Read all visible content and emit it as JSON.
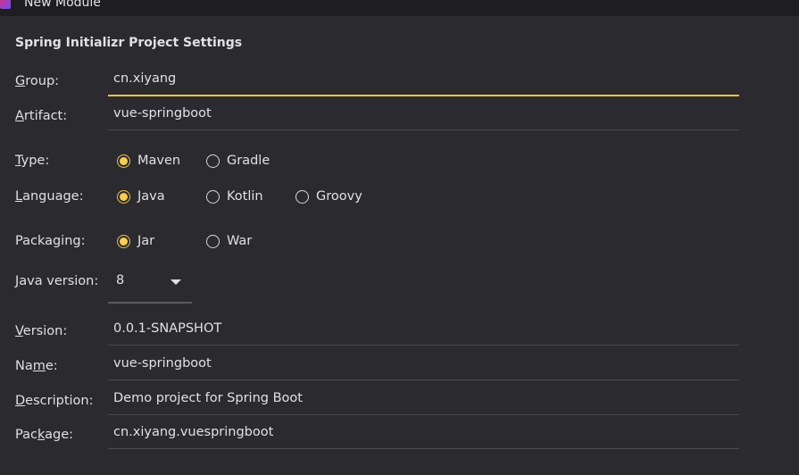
{
  "window": {
    "title": "New Module"
  },
  "section_title": "Spring Initializr Project Settings",
  "accent_color": "#f7cd55",
  "fields": {
    "group": {
      "label_m": "G",
      "label_r": "roup:",
      "value": "cn.xiyang"
    },
    "artifact": {
      "label_m": "A",
      "label_r": "rtifact:",
      "value": "vue-springboot"
    },
    "version": {
      "label_m": "V",
      "label_r": "ersion:",
      "value": "0.0.1-SNAPSHOT"
    },
    "name": {
      "label_l": "Na",
      "label_m": "m",
      "label_r": "e:",
      "value": "vue-springboot"
    },
    "description": {
      "label_m": "D",
      "label_r": "escription:",
      "value": "Demo project for Spring Boot"
    },
    "package": {
      "label_l": "Pac",
      "label_m": "k",
      "label_r": "age:",
      "value": "cn.xiyang.vuespringboot"
    }
  },
  "type": {
    "label_m": "T",
    "label_r": "ype:",
    "options": [
      "Maven",
      "Gradle"
    ],
    "selected": "Maven"
  },
  "language": {
    "label_m": "L",
    "label_r": "anguage:",
    "options": [
      "Java",
      "Kotlin",
      "Groovy"
    ],
    "selected": "Java"
  },
  "packaging": {
    "label": "Packaging:",
    "options": [
      "Jar",
      "War"
    ],
    "selected": "Jar"
  },
  "java_version": {
    "label_m": "J",
    "label_r": "ava version:",
    "value": "8"
  }
}
